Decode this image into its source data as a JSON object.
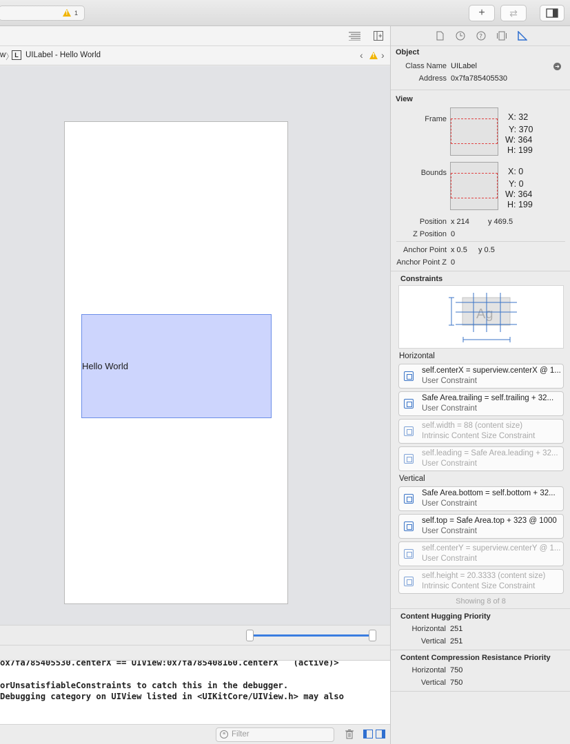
{
  "toolbar": {
    "warning_count": "1",
    "add_label": "+",
    "swap_label": "⇄"
  },
  "jumpbar": {
    "prev_item": "w",
    "item_badge": "L",
    "item_title": "UILabel - Hello World"
  },
  "canvas": {
    "label_text": "Hello World"
  },
  "console": {
    "lines": [
      "ox7fa785405530.centerX == UIView:0x7fa785408160.centerX   (active)>",
      "orUnsatisfiableConstraints to catch this in the debugger.",
      "Debugging category on UIView listed in <UIKitCore/UIView.h> may also"
    ],
    "filter_placeholder": "Filter"
  },
  "inspector": {
    "object": {
      "title": "Object",
      "class_name_label": "Class Name",
      "class_name": "UILabel",
      "address_label": "Address",
      "address": "0x7fa785405530"
    },
    "view": {
      "title": "View",
      "frame_label": "Frame",
      "frame": {
        "x": "X: 32",
        "y": "Y: 370",
        "w": "W: 364",
        "h": "H: 199"
      },
      "bounds_label": "Bounds",
      "bounds": {
        "x": "X: 0",
        "y": "Y: 0",
        "w": "W: 364",
        "h": "H: 199"
      },
      "position_label": "Position",
      "position_x": "x  214",
      "position_y": "y  469.5",
      "z_position_label": "Z Position",
      "z_position": "0",
      "anchor_label": "Anchor Point",
      "anchor_x": "x  0.5",
      "anchor_y": "y  0.5",
      "anchor_z_label": "Anchor Point Z",
      "anchor_z": "0"
    },
    "constraints": {
      "title": "Constraints",
      "preview_text": "Ag",
      "horizontal_title": "Horizontal",
      "horizontal": [
        {
          "expr": "self.centerX = superview.centerX @ 1...",
          "type": "User Constraint",
          "active": true
        },
        {
          "expr": "Safe Area.trailing = self.trailing + 32...",
          "type": "User Constraint",
          "active": true
        },
        {
          "expr": "self.width = 88 (content size)",
          "type": "Intrinsic Content Size Constraint",
          "active": false
        },
        {
          "expr": "self.leading = Safe Area.leading + 32...",
          "type": "User Constraint",
          "active": false
        }
      ],
      "vertical_title": "Vertical",
      "vertical": [
        {
          "expr": "Safe Area.bottom = self.bottom + 32...",
          "type": "User Constraint",
          "active": true
        },
        {
          "expr": "self.top = Safe Area.top + 323 @ 1000",
          "type": "User Constraint",
          "active": true
        },
        {
          "expr": "self.centerY = superview.centerY @ 1...",
          "type": "User Constraint",
          "active": false
        },
        {
          "expr": "self.height = 20.3333 (content size)",
          "type": "Intrinsic Content Size Constraint",
          "active": false
        }
      ],
      "showing": "Showing 8 of 8"
    },
    "hugging": {
      "title": "Content Hugging Priority",
      "horizontal_label": "Horizontal",
      "horizontal": "251",
      "vertical_label": "Vertical",
      "vertical": "251"
    },
    "compression": {
      "title": "Content Compression Resistance Priority",
      "horizontal_label": "Horizontal",
      "horizontal": "750",
      "vertical_label": "Vertical",
      "vertical": "750"
    }
  },
  "colors": {
    "accent": "#3873c7",
    "label_fill": "#cdd5fd",
    "warning": "#f0b400"
  }
}
